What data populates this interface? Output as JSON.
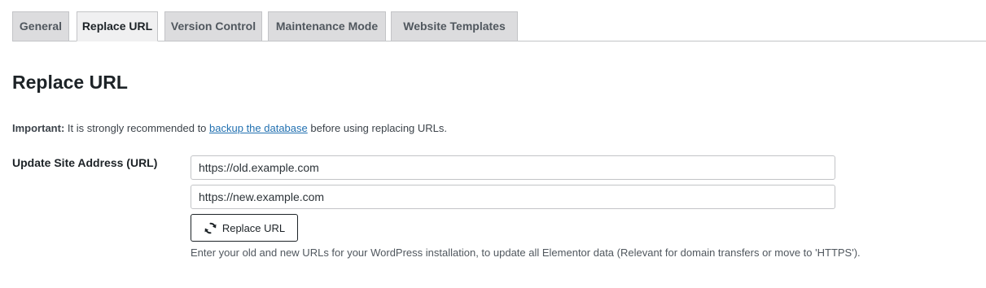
{
  "tabs": [
    {
      "label": "General",
      "active": false
    },
    {
      "label": "Replace URL",
      "active": true
    },
    {
      "label": "Version Control",
      "active": false
    },
    {
      "label": "Maintenance Mode",
      "active": false
    },
    {
      "label": "Website Templates",
      "active": false
    }
  ],
  "page": {
    "title": "Replace URL"
  },
  "notice": {
    "strong": "Important:",
    "text_before": " It is strongly recommended to ",
    "link": "backup the database",
    "text_after": " before using replacing URLs."
  },
  "form": {
    "label": "Update Site Address (URL)",
    "old_url_value": "https://old.example.com",
    "new_url_value": "https://new.example.com",
    "button_label": "Replace URL",
    "button_icon": "refresh-icon",
    "description": "Enter your old and new URLs for your WordPress installation, to update all Elementor data (Relevant for domain transfers or move to 'HTTPS')."
  },
  "colors": {
    "link": "#2271b1",
    "text": "#1d2327",
    "border": "#c3c4c7"
  }
}
